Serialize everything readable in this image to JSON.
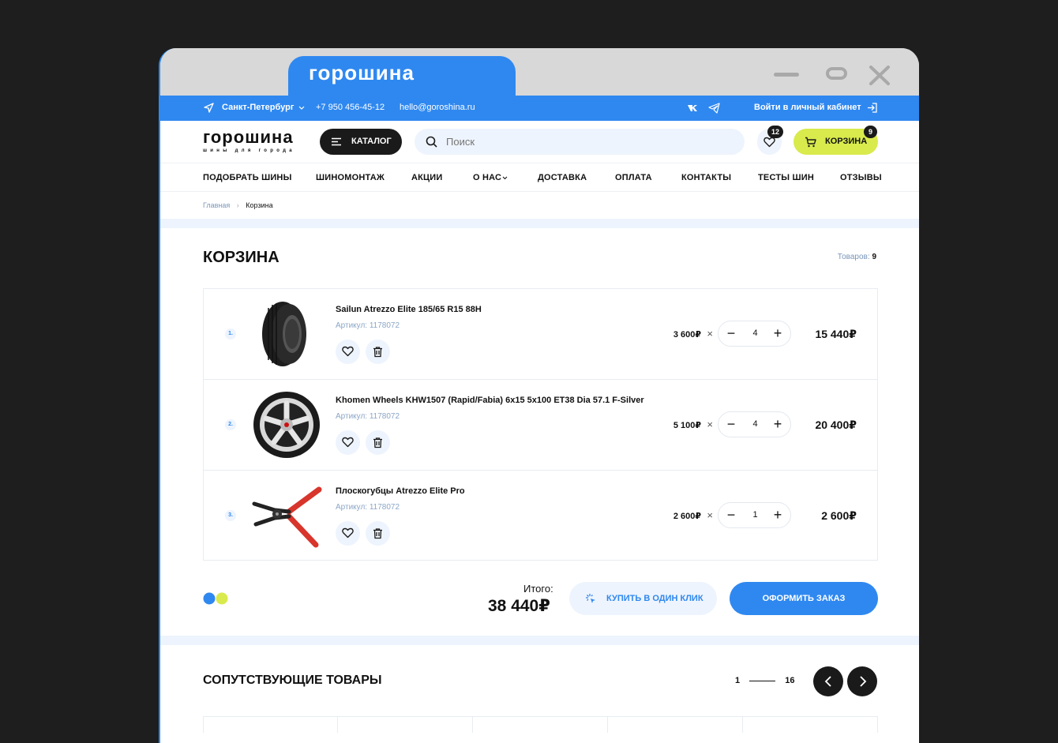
{
  "window": {
    "tab_title": "горошина"
  },
  "topbar": {
    "city": "Санкт-Петербург",
    "phone": "+7 950 456-45-12",
    "email": "hello@goroshina.ru",
    "login": "Войти в личный кабинет"
  },
  "header": {
    "logo": "горошина",
    "logo_sub": "шины для города",
    "catalog_label": "КАТАЛОГ",
    "search_placeholder": "Поиск",
    "favorites_count": "12",
    "cart_label": "КОРЗИНА",
    "cart_count": "9"
  },
  "nav": {
    "items": [
      "ПОДОБРАТЬ ШИНЫ",
      "ШИНОМОНТАЖ",
      "АКЦИИ",
      "О НАС",
      "ДОСТАВКА",
      "ОПЛАТА",
      "КОНТАКТЫ",
      "ТЕСТЫ ШИН",
      "ОТЗЫВЫ"
    ]
  },
  "breadcrumb": {
    "home": "Главная",
    "current": "Корзина"
  },
  "cart": {
    "title": "КОРЗИНА",
    "count_label": "Товаров:",
    "count_value": "9",
    "items": [
      {
        "num": "1.",
        "name": "Sailun Atrezzo Elite 185/65 R15 88H",
        "article": "Артикул: 1178072",
        "unit_price": "3 600₽",
        "qty": "4",
        "total": "15 440₽"
      },
      {
        "num": "2.",
        "name": "Khomen Wheels KHW1507 (Rapid/Fabia) 6x15 5x100 ET38 Dia 57.1 F-Silver",
        "article": "Артикул: 1178072",
        "unit_price": "5 100₽",
        "qty": "4",
        "total": "20 400₽"
      },
      {
        "num": "3.",
        "name": "Плоскогубцы Atrezzo Elite Pro",
        "article": "Артикул: 1178072",
        "unit_price": "2 600₽",
        "qty": "1",
        "total": "2 600₽"
      }
    ],
    "itogo_label": "Итого:",
    "sum": "38 440₽",
    "one_click_label": "КУПИТЬ В ОДИН КЛИК",
    "order_label": "ОФОРМИТЬ ЗАКАЗ"
  },
  "related": {
    "title": "СОПУТСТВУЮЩИЕ ТОВАРЫ",
    "page_current": "1",
    "page_total": "16"
  },
  "colors": {
    "accent": "#2f88f0",
    "lime": "#d9ea4c",
    "dark": "#1a1a1a",
    "light_bg": "#eef4fd"
  }
}
